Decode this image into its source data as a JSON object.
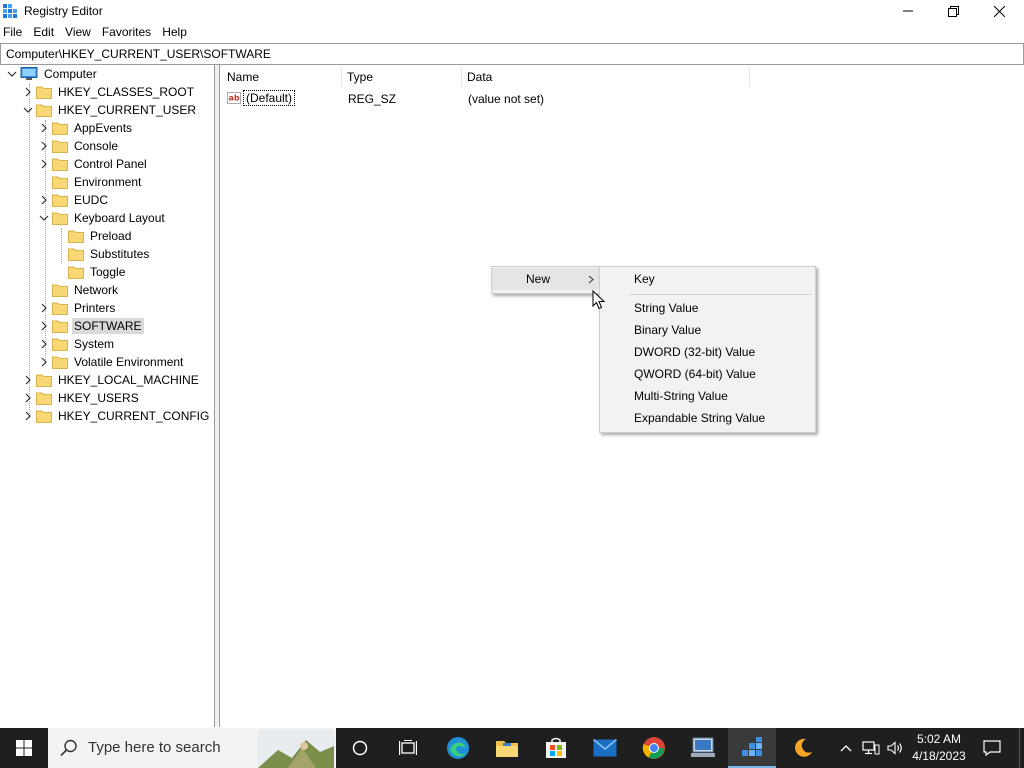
{
  "window": {
    "title": "Registry Editor",
    "icon": "registry-icon",
    "controls": [
      "minimize-icon",
      "restore-icon",
      "close-icon"
    ]
  },
  "menu": [
    "File",
    "Edit",
    "View",
    "Favorites",
    "Help"
  ],
  "address": "Computer\\HKEY_CURRENT_USER\\SOFTWARE",
  "tree": {
    "root": "Computer",
    "hkcr": "HKEY_CLASSES_ROOT",
    "hkcu": "HKEY_CURRENT_USER",
    "hkcu_children": {
      "appevents": "AppEvents",
      "console": "Console",
      "control_panel": "Control Panel",
      "environment": "Environment",
      "eudc": "EUDC",
      "keyboard_layout": "Keyboard Layout",
      "preload": "Preload",
      "substitutes": "Substitutes",
      "toggle": "Toggle",
      "network": "Network",
      "printers": "Printers",
      "software": "SOFTWARE",
      "system": "System",
      "volatile_environment": "Volatile Environment"
    },
    "hklm": "HKEY_LOCAL_MACHINE",
    "hku": "HKEY_USERS",
    "hkcc": "HKEY_CURRENT_CONFIG",
    "selected": "SOFTWARE"
  },
  "list": {
    "columns": {
      "name": "Name",
      "type": "Type",
      "data": "Data"
    },
    "rows": [
      {
        "name": "(Default)",
        "type": "REG_SZ",
        "data": "(value not set)"
      }
    ]
  },
  "context_menu": {
    "new_label": "New"
  },
  "submenu": {
    "key": "Key",
    "string_value": "String Value",
    "binary_value": "Binary Value",
    "dword_value": "DWORD (32-bit) Value",
    "qword_value": "QWORD (64-bit) Value",
    "multi_string_value": "Multi-String Value",
    "expandable_string_value": "Expandable String Value"
  },
  "taskbar": {
    "search_placeholder": "Type here to search",
    "apps": [
      "cortana-icon",
      "task-view-icon",
      "edge-icon",
      "file-explorer-icon",
      "store-icon",
      "mail-icon",
      "chrome-icon",
      "remote-desktop-icon",
      "registry-editor-icon",
      "night-light-icon"
    ],
    "time": "5:02 AM",
    "date": "4/18/2023"
  },
  "colors": {
    "folder": "#f8d775",
    "taskbar": "#1f1f1f",
    "accent": "#76b9ed",
    "selection": "#d9d9d9"
  }
}
